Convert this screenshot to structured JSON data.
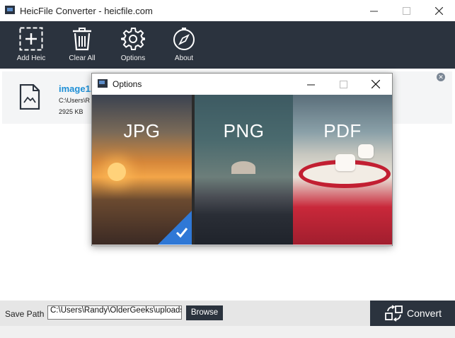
{
  "app": {
    "title": "HeicFile Converter - heicfile.com"
  },
  "toolbar": {
    "items": [
      {
        "label": "Add Heic",
        "icon": "add-icon"
      },
      {
        "label": "Clear All",
        "icon": "trash-icon"
      },
      {
        "label": "Options",
        "icon": "gear-icon"
      },
      {
        "label": "About",
        "icon": "compass-icon"
      }
    ]
  },
  "files": [
    {
      "name": "image1.",
      "path": "C:\\Users\\R",
      "size": "2925 KB"
    }
  ],
  "bottom": {
    "save_label": "Save Path",
    "save_path": "C:\\Users\\Randy\\OlderGeeks\\uploads",
    "browse_label": "Browse",
    "convert_label": "Convert"
  },
  "options_dialog": {
    "title": "Options",
    "formats": [
      {
        "label": "JPG",
        "selected": true
      },
      {
        "label": "PNG",
        "selected": false
      },
      {
        "label": "PDF",
        "selected": false
      }
    ],
    "selected_color": "#2f78d6"
  },
  "colors": {
    "toolbar_bg": "#2b333e",
    "file_name": "#1e8fd6"
  }
}
